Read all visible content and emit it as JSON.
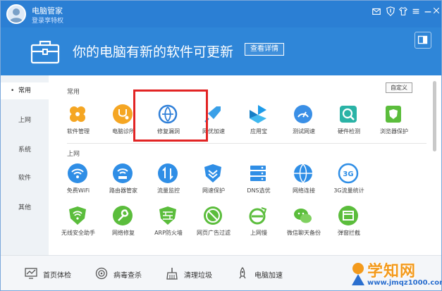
{
  "titlebar": {
    "app_title": "电脑管家",
    "vip_link": "登录享特权"
  },
  "banner": {
    "message": "你的电脑有新的软件可更新",
    "detail_button": "查看详情"
  },
  "sidebar": {
    "items": [
      {
        "label": "常用",
        "active": true
      },
      {
        "label": "上网",
        "active": false
      },
      {
        "label": "系统",
        "active": false
      },
      {
        "label": "软件",
        "active": false
      },
      {
        "label": "其他",
        "active": false
      }
    ]
  },
  "main": {
    "customize_button": "自定义",
    "sections": [
      {
        "title": "常用",
        "tools": [
          {
            "label": "软件管理",
            "icon": "clover-icon",
            "color": "#f5a623"
          },
          {
            "label": "电脑诊所",
            "icon": "stethoscope-icon",
            "color": "#f5a623"
          },
          {
            "label": "修复漏洞",
            "icon": "globe-repair-icon",
            "color": "#2f7fd8"
          },
          {
            "label": "网优加速",
            "icon": "rocket-icon",
            "color": "#3aa0e8"
          },
          {
            "label": "应用宝",
            "icon": "app-store-icon",
            "color": "#1e9be9"
          },
          {
            "label": "测试网速",
            "icon": "speedometer-icon",
            "color": "#3a8fe6"
          },
          {
            "label": "硬件检测",
            "icon": "hardware-scan-icon",
            "color": "#2ab3a6"
          },
          {
            "label": "浏览器保护",
            "icon": "browser-shield-icon",
            "color": "#5bbd3c"
          }
        ]
      },
      {
        "title": "上网",
        "tools": [
          {
            "label": "免费WiFi",
            "icon": "wifi-icon",
            "color": "#2f8ee6"
          },
          {
            "label": "路由器管家",
            "icon": "router-wifi-icon",
            "color": "#2f8ee6"
          },
          {
            "label": "流量监控",
            "icon": "traffic-arrows-icon",
            "color": "#2f8ee6"
          },
          {
            "label": "网速保护",
            "icon": "shield-chevron-icon",
            "color": "#2f8ee6"
          },
          {
            "label": "DNS选优",
            "icon": "server-stack-icon",
            "color": "#2f8ee6"
          },
          {
            "label": "网络连接",
            "icon": "globe-icon",
            "color": "#2f8ee6"
          },
          {
            "label": "3G流量统计",
            "icon": "3g-icon",
            "color": "#2f8ee6"
          }
        ]
      },
      {
        "title": "",
        "tools": [
          {
            "label": "无线安全助手",
            "icon": "wifi-shield-icon",
            "color": "#5bbd3c"
          },
          {
            "label": "网络修复",
            "icon": "wrench-icon",
            "color": "#5bbd3c"
          },
          {
            "label": "ARP防火墙",
            "icon": "firewall-icon",
            "color": "#5bbd3c"
          },
          {
            "label": "网页广告过滤",
            "icon": "ad-filter-icon",
            "color": "#5bbd3c"
          },
          {
            "label": "上网慢",
            "icon": "ie-slow-icon",
            "color": "#5bbd3c"
          },
          {
            "label": "微信聊天备份",
            "icon": "wechat-icon",
            "color": "#5bbd3c"
          },
          {
            "label": "弹窗拦截",
            "icon": "popup-block-icon",
            "color": "#5bbd3c"
          }
        ]
      }
    ]
  },
  "bottombar": {
    "items": [
      {
        "label": "首页体检",
        "icon": "monitor-chart-icon"
      },
      {
        "label": "病毒查杀",
        "icon": "virus-scan-icon"
      },
      {
        "label": "清理垃圾",
        "icon": "broom-icon"
      },
      {
        "label": "电脑加速",
        "icon": "rocket-outline-icon"
      }
    ]
  },
  "watermark": {
    "brand": "学知网",
    "domain": "www.jmqz1000.com"
  },
  "colors": {
    "titlebar": "#2b7fd4",
    "banner": "#2f86d8",
    "highlight_box": "#e22424",
    "watermark_orange": "#f39a1c",
    "watermark_blue": "#2b6fcf"
  }
}
